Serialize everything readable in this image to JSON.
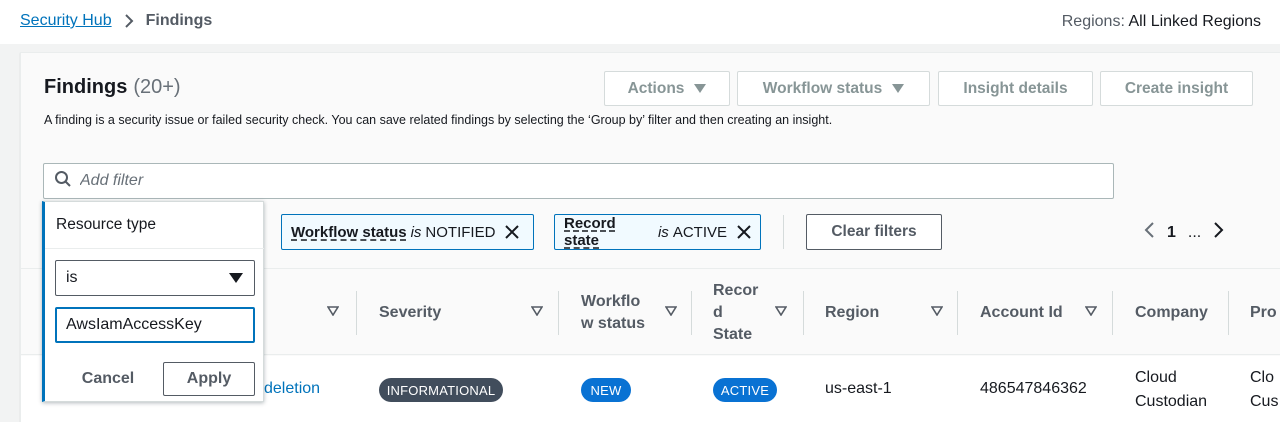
{
  "breadcrumb": {
    "home": "Security Hub",
    "current": "Findings"
  },
  "regions": {
    "label": "Regions:",
    "value": "All Linked Regions"
  },
  "panel": {
    "title": "Findings",
    "count": "(20+)",
    "description": "A finding is a security issue or failed security check. You can save related findings by selecting the ‘Group by’ filter and then creating an insight.",
    "buttons": {
      "actions": "Actions",
      "workflow": "Workflow status",
      "insight_details": "Insight details",
      "create_insight": "Create insight"
    },
    "filter_placeholder": "Add filter"
  },
  "tokens": [
    {
      "key": "Workflow status",
      "op": "is",
      "value": "NOTIFIED"
    },
    {
      "key": "Record state",
      "op": "is",
      "value": "ACTIVE"
    }
  ],
  "clear_filters": "Clear filters",
  "pagination": {
    "page": "1",
    "ellipsis": "..."
  },
  "table": {
    "headers": {
      "severity": "Severity",
      "workflow": "Workflo\nw status",
      "record": "Recor\nd\nState",
      "region": "Region",
      "account": "Account Id",
      "company": "Company",
      "product": "Pro"
    },
    "row": {
      "title_fragment": "deletion",
      "severity": "INFORMATIONAL",
      "workflow": "NEW",
      "record": "ACTIVE",
      "region": "us-east-1",
      "account": "486547846362",
      "company": "Cloud\nCustodian",
      "product": "Clo\nCus"
    }
  },
  "popover": {
    "title": "Resource type",
    "operator": "is",
    "value": "AwsIamAccessKey",
    "cancel": "Cancel",
    "apply": "Apply"
  },
  "colors": {
    "link": "#0073bb",
    "informational": "#414d5c",
    "status_blue": "#0972d3"
  }
}
